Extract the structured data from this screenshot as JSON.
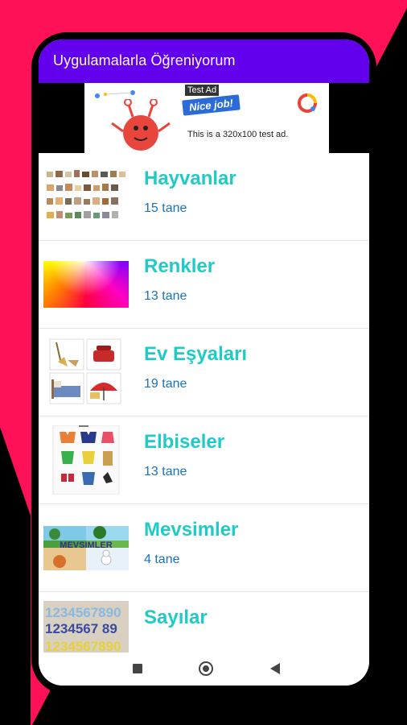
{
  "app": {
    "title": "Uygulamalarla Öğreniyorum"
  },
  "ad": {
    "badge": "Test Ad",
    "headline": "Nice job!",
    "description": "This is a 320x100 test ad."
  },
  "categories": [
    {
      "name": "Hayvanlar",
      "count": "15 tane",
      "thumb": "animals-thumbnail"
    },
    {
      "name": "Renkler",
      "count": "13 tane",
      "thumb": "color-gradient-thumbnail"
    },
    {
      "name": "Ev Eşyaları",
      "count": "19 tane",
      "thumb": "household-items-thumbnail"
    },
    {
      "name": "Elbiseler",
      "count": "13 tane",
      "thumb": "clothes-thumbnail"
    },
    {
      "name": "Mevsimler",
      "count": "4 tane",
      "thumb": "seasons-thumbnail"
    },
    {
      "name": "Sayılar",
      "count": "",
      "thumb": "numbers-thumbnail"
    }
  ],
  "thumb_text": {
    "seasons_banner": "MEVSIMLER",
    "numbers_row1": "1234567890",
    "numbers_row2": "1234567 89"
  },
  "navbar": {
    "recents_icon": "square-icon",
    "home_icon": "circle-icon",
    "back_icon": "triangle-back-icon"
  },
  "colors": {
    "appbar": "#6200EE",
    "category_title": "#1ECBC6",
    "category_count": "#1A74B8",
    "background_accent": "#FF1157"
  }
}
